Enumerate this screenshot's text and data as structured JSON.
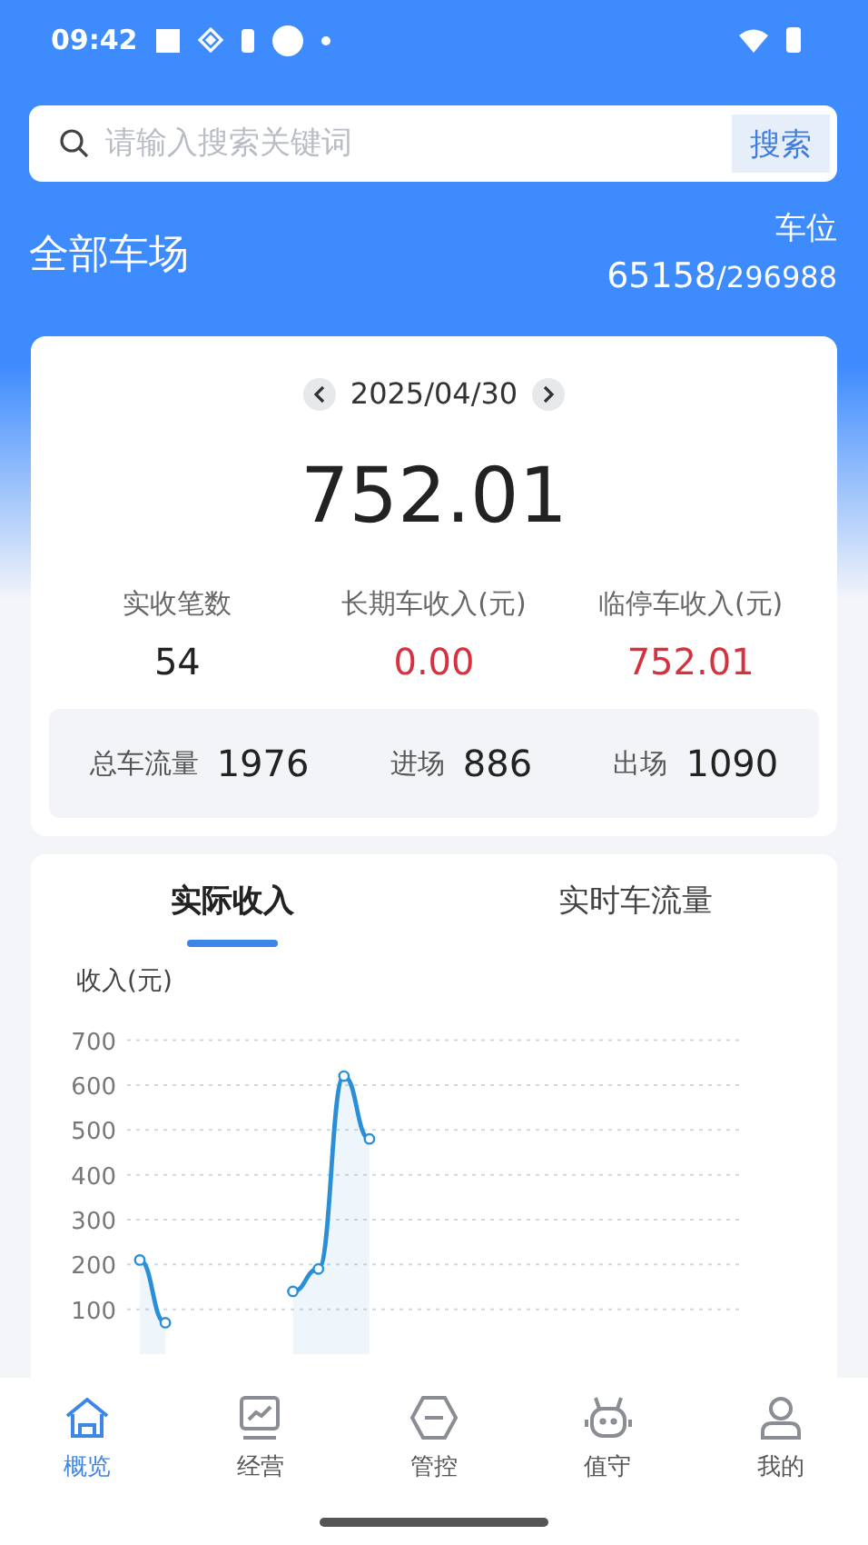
{
  "status_bar": {
    "time": "09:42"
  },
  "search": {
    "placeholder": "请输入搜索关键词",
    "button": "搜索"
  },
  "header": {
    "title": "全部车场",
    "spaces_label": "车位",
    "spaces_used": "65158",
    "spaces_total": "/296988"
  },
  "summary": {
    "date": "2025/04/30",
    "total": "752.01",
    "stats": [
      {
        "label": "实收笔数",
        "value": "54",
        "kind": "plain"
      },
      {
        "label": "长期车收入(元)",
        "value": "0.00",
        "kind": "money"
      },
      {
        "label": "临停车收入(元)",
        "value": "752.01",
        "kind": "money"
      }
    ],
    "flow": [
      {
        "label": "总车流量",
        "value": "1976"
      },
      {
        "label": "进场",
        "value": "886"
      },
      {
        "label": "出场",
        "value": "1090"
      }
    ]
  },
  "chart_tabs": [
    {
      "label": "实际收入",
      "selected": true
    },
    {
      "label": "实时车流量",
      "selected": false
    }
  ],
  "chart_data": {
    "type": "area",
    "ylabel": "收入(元)",
    "grid": true,
    "ylim": [
      0,
      700
    ],
    "yticks": [
      100,
      200,
      300,
      400,
      500,
      600,
      700
    ],
    "series": [
      {
        "color": "#2a8fd6",
        "values": [
          210,
          70,
          null,
          null,
          null,
          null,
          140,
          190,
          620,
          480,
          null,
          null,
          null,
          null,
          null,
          null,
          null,
          null,
          null,
          null,
          null,
          null,
          null,
          null
        ]
      }
    ]
  },
  "nav": [
    {
      "label": "概览",
      "selected": true
    },
    {
      "label": "经营",
      "selected": false
    },
    {
      "label": "管控",
      "selected": false
    },
    {
      "label": "值守",
      "selected": false
    },
    {
      "label": "我的",
      "selected": false
    }
  ]
}
